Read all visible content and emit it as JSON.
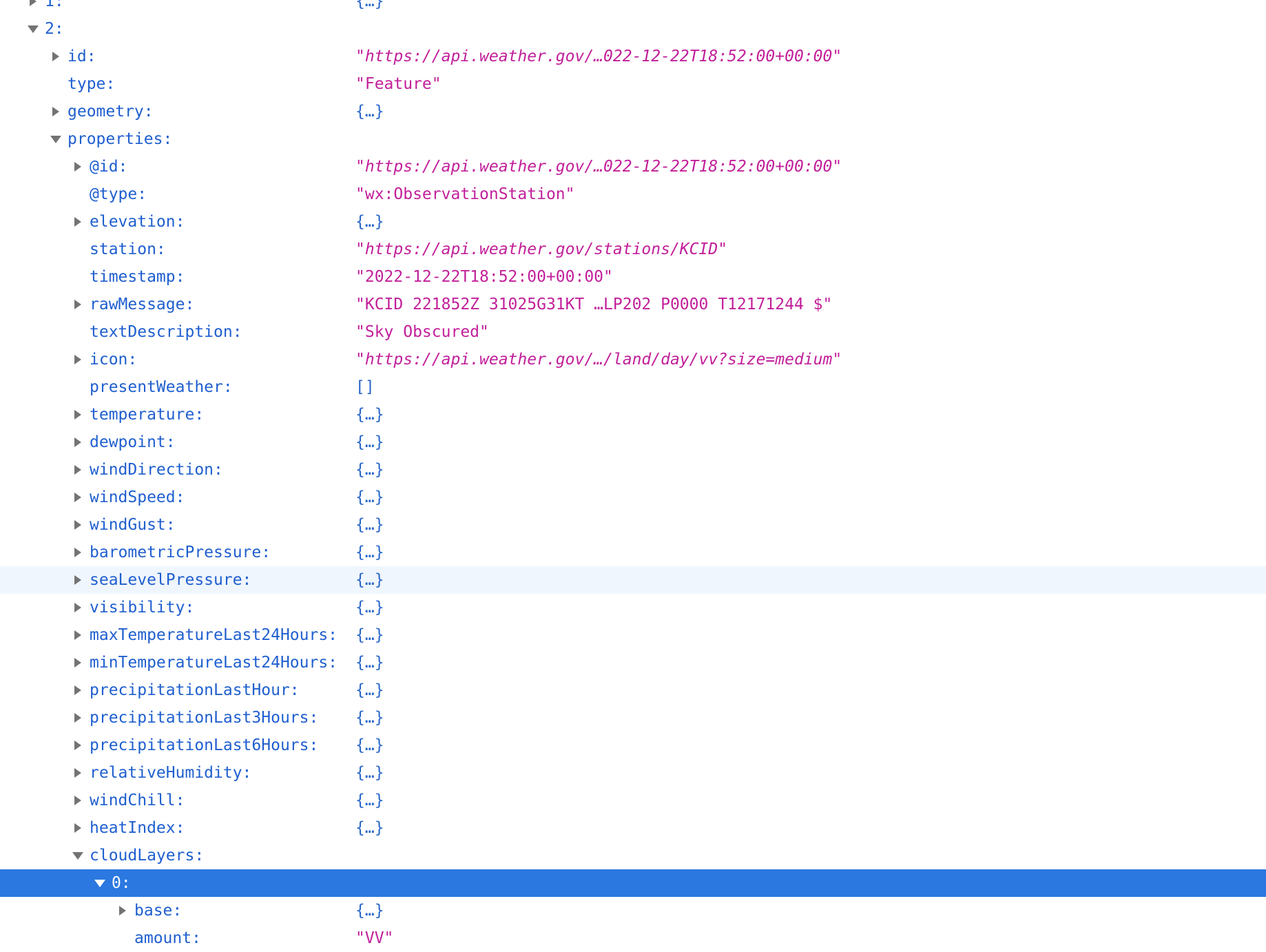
{
  "rows": [
    {
      "key": "1:",
      "value": "{…}",
      "type": "obj",
      "depth": 0,
      "twisty": "closed",
      "state": ""
    },
    {
      "key": "2:",
      "value": "",
      "type": "none",
      "depth": 0,
      "twisty": "open",
      "state": ""
    },
    {
      "key": "id:",
      "value": "\"https://api.weather.gov/…022-12-22T18:52:00+00:00\"",
      "type": "url",
      "depth": 1,
      "twisty": "closed",
      "state": ""
    },
    {
      "key": "type:",
      "value": "\"Feature\"",
      "type": "str",
      "depth": 1,
      "twisty": "none",
      "state": ""
    },
    {
      "key": "geometry:",
      "value": "{…}",
      "type": "obj",
      "depth": 1,
      "twisty": "closed",
      "state": ""
    },
    {
      "key": "properties:",
      "value": "",
      "type": "none",
      "depth": 1,
      "twisty": "open",
      "state": ""
    },
    {
      "key": "@id:",
      "value": "\"https://api.weather.gov/…022-12-22T18:52:00+00:00\"",
      "type": "url",
      "depth": 2,
      "twisty": "closed",
      "state": ""
    },
    {
      "key": "@type:",
      "value": "\"wx:ObservationStation\"",
      "type": "str",
      "depth": 2,
      "twisty": "none",
      "state": ""
    },
    {
      "key": "elevation:",
      "value": "{…}",
      "type": "obj",
      "depth": 2,
      "twisty": "closed",
      "state": ""
    },
    {
      "key": "station:",
      "value": "\"https://api.weather.gov/stations/KCID\"",
      "type": "url",
      "depth": 2,
      "twisty": "none",
      "state": ""
    },
    {
      "key": "timestamp:",
      "value": "\"2022-12-22T18:52:00+00:00\"",
      "type": "str",
      "depth": 2,
      "twisty": "none",
      "state": ""
    },
    {
      "key": "rawMessage:",
      "value": "\"KCID 221852Z 31025G31KT …LP202 P0000 T12171244 $\"",
      "type": "str",
      "depth": 2,
      "twisty": "closed",
      "state": ""
    },
    {
      "key": "textDescription:",
      "value": "\"Sky Obscured\"",
      "type": "str",
      "depth": 2,
      "twisty": "none",
      "state": ""
    },
    {
      "key": "icon:",
      "value": "\"https://api.weather.gov/…/land/day/vv?size=medium\"",
      "type": "url",
      "depth": 2,
      "twisty": "closed",
      "state": ""
    },
    {
      "key": "presentWeather:",
      "value": "[]",
      "type": "obj",
      "depth": 2,
      "twisty": "none",
      "state": ""
    },
    {
      "key": "temperature:",
      "value": "{…}",
      "type": "obj",
      "depth": 2,
      "twisty": "closed",
      "state": ""
    },
    {
      "key": "dewpoint:",
      "value": "{…}",
      "type": "obj",
      "depth": 2,
      "twisty": "closed",
      "state": ""
    },
    {
      "key": "windDirection:",
      "value": "{…}",
      "type": "obj",
      "depth": 2,
      "twisty": "closed",
      "state": ""
    },
    {
      "key": "windSpeed:",
      "value": "{…}",
      "type": "obj",
      "depth": 2,
      "twisty": "closed",
      "state": ""
    },
    {
      "key": "windGust:",
      "value": "{…}",
      "type": "obj",
      "depth": 2,
      "twisty": "closed",
      "state": ""
    },
    {
      "key": "barometricPressure:",
      "value": "{…}",
      "type": "obj",
      "depth": 2,
      "twisty": "closed",
      "state": ""
    },
    {
      "key": "seaLevelPressure:",
      "value": "{…}",
      "type": "obj",
      "depth": 2,
      "twisty": "closed",
      "state": "hover"
    },
    {
      "key": "visibility:",
      "value": "{…}",
      "type": "obj",
      "depth": 2,
      "twisty": "closed",
      "state": ""
    },
    {
      "key": "maxTemperatureLast24Hours:",
      "value": "{…}",
      "type": "obj",
      "depth": 2,
      "twisty": "closed",
      "state": ""
    },
    {
      "key": "minTemperatureLast24Hours:",
      "value": "{…}",
      "type": "obj",
      "depth": 2,
      "twisty": "closed",
      "state": ""
    },
    {
      "key": "precipitationLastHour:",
      "value": "{…}",
      "type": "obj",
      "depth": 2,
      "twisty": "closed",
      "state": ""
    },
    {
      "key": "precipitationLast3Hours:",
      "value": "{…}",
      "type": "obj",
      "depth": 2,
      "twisty": "closed",
      "state": ""
    },
    {
      "key": "precipitationLast6Hours:",
      "value": "{…}",
      "type": "obj",
      "depth": 2,
      "twisty": "closed",
      "state": ""
    },
    {
      "key": "relativeHumidity:",
      "value": "{…}",
      "type": "obj",
      "depth": 2,
      "twisty": "closed",
      "state": ""
    },
    {
      "key": "windChill:",
      "value": "{…}",
      "type": "obj",
      "depth": 2,
      "twisty": "closed",
      "state": ""
    },
    {
      "key": "heatIndex:",
      "value": "{…}",
      "type": "obj",
      "depth": 2,
      "twisty": "closed",
      "state": ""
    },
    {
      "key": "cloudLayers:",
      "value": "",
      "type": "none",
      "depth": 2,
      "twisty": "open",
      "state": ""
    },
    {
      "key": "0:",
      "value": "",
      "type": "none",
      "depth": 3,
      "twisty": "open",
      "state": "selected"
    },
    {
      "key": "base:",
      "value": "{…}",
      "type": "obj",
      "depth": 4,
      "twisty": "closed",
      "state": ""
    },
    {
      "key": "amount:",
      "value": "\"VV\"",
      "type": "str",
      "depth": 4,
      "twisty": "none",
      "state": ""
    }
  ]
}
